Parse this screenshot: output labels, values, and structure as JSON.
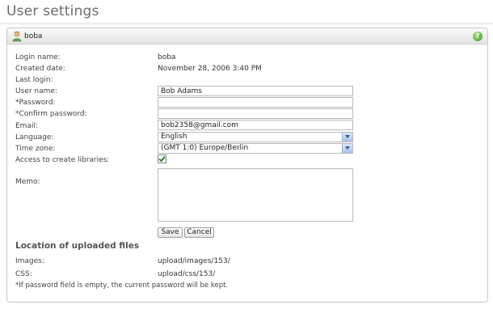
{
  "page": {
    "title": "User settings"
  },
  "panel": {
    "username": "boba",
    "help_symbol": "?"
  },
  "fields": {
    "login_name": {
      "label": "Login name:",
      "value": "boba"
    },
    "created_date": {
      "label": "Created date:",
      "value": "November 28, 2006 3:40 PM"
    },
    "last_login": {
      "label": "Last login:",
      "value": ""
    },
    "user_name": {
      "label": "User name:",
      "value": "Bob Adams",
      "placeholder": ""
    },
    "password": {
      "label": "*Password:",
      "value": ""
    },
    "confirm_password": {
      "label": "*Confirm password:",
      "value": ""
    },
    "email": {
      "label": "Email:",
      "value": "bob2358@gmail.com"
    },
    "language": {
      "label": "Language:",
      "selected": "English"
    },
    "time_zone": {
      "label": "Time zone:",
      "selected": "(GMT 1:0) Europe/Berlin"
    },
    "access_libraries": {
      "label": "Access to create libraries:",
      "checked": true
    },
    "memo": {
      "label": "Memo:",
      "value": ""
    }
  },
  "buttons": {
    "save": "Save",
    "cancel": "Cancel"
  },
  "uploads": {
    "title": "Location of uploaded files",
    "images_label": "Images:",
    "images_path": "upload/images/153/",
    "css_label": "CSS:",
    "css_path": "upload/css/153/"
  },
  "note": "*If password field is empty, the current password will be kept.",
  "colors": {
    "title_text": "#6a6a6a",
    "panel_border": "#c8c8c8",
    "select_arrow": "#a8c3ee",
    "check_mark": "#1f7a1f",
    "help_icon": "#3f9a24"
  },
  "icons": {
    "user": "user-icon",
    "help": "help-icon",
    "dropdown": "chevron-down-icon",
    "check": "checkmark-icon"
  }
}
